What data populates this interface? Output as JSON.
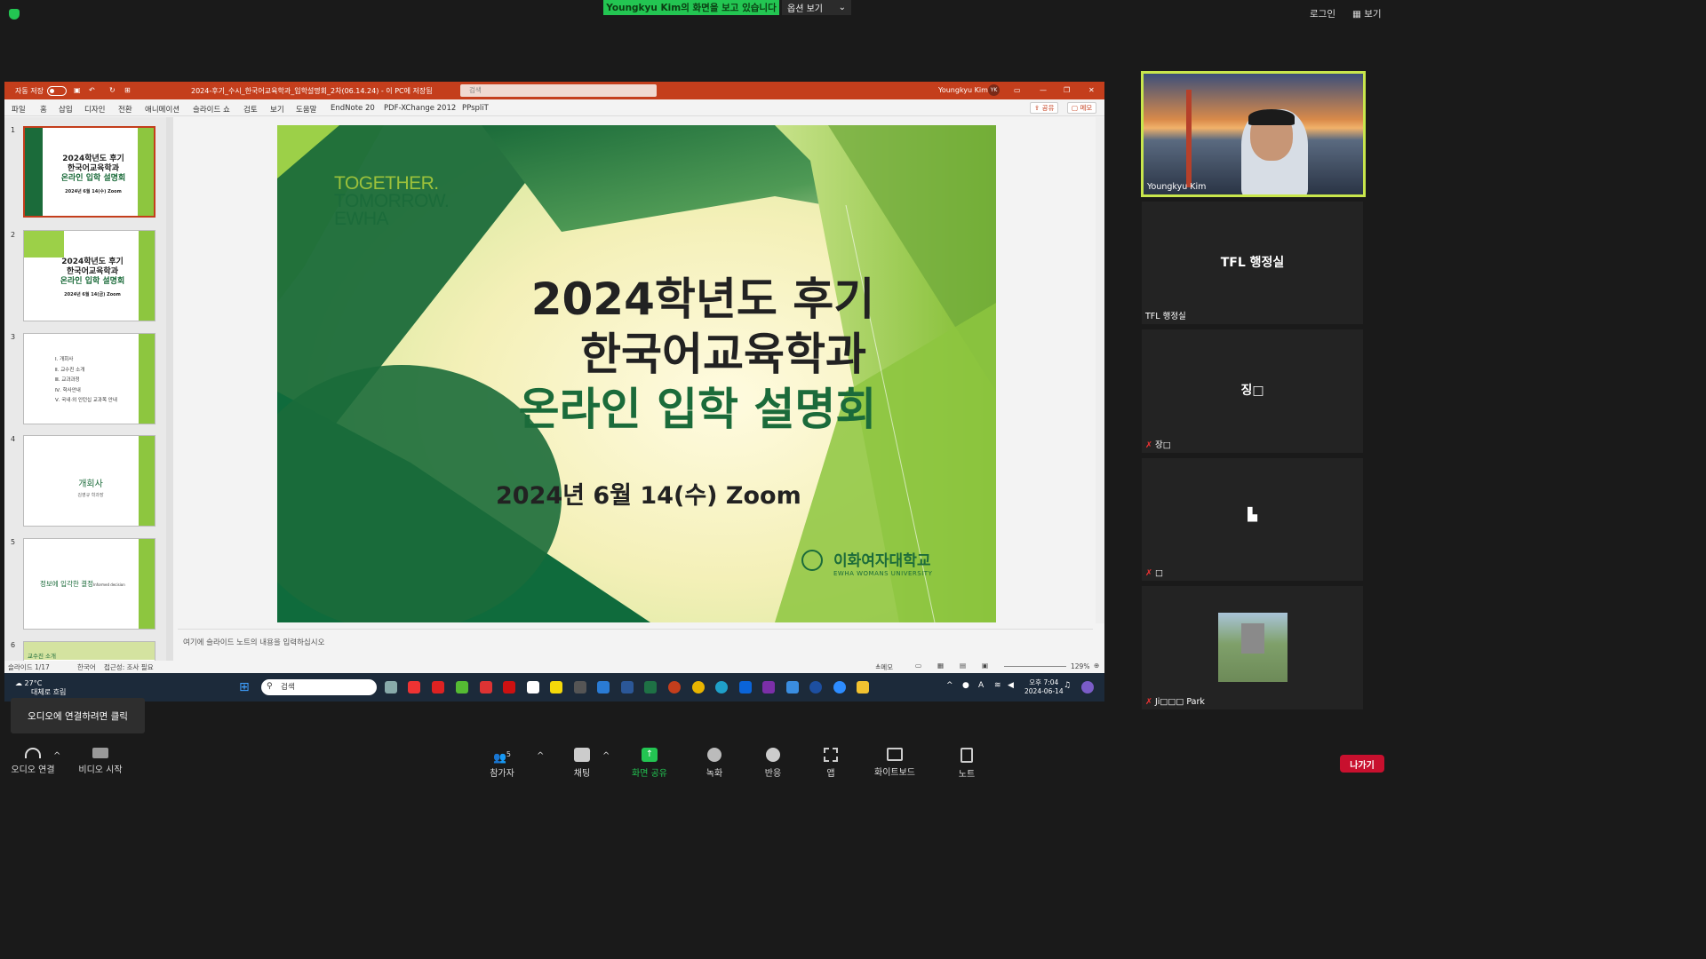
{
  "zoom": {
    "banner": "Youngkyu  Kim의 화면을 보고 있습니다",
    "view_options": "옵션 보기",
    "login": "로그인",
    "view": "보기",
    "audio_tooltip": "오디오에 연결하려면 클릭",
    "participants_count": "5",
    "controls": {
      "audio": "오디오 연결",
      "video": "비디오 시작",
      "participants": "참가자",
      "chat": "채팅",
      "share": "화면 공유",
      "record": "녹화",
      "reactions": "반응",
      "apps": "앱",
      "whiteboard": "화이트보드",
      "notes": "노트",
      "leave": "나가기"
    },
    "tiles": [
      {
        "name": "Youngkyu Kim"
      },
      {
        "center": "TFL 행정실",
        "name": "TFL 행정실"
      },
      {
        "center": "징□",
        "name": "장□"
      },
      {
        "center": "▙",
        "name": "□"
      },
      {
        "name": "Ji□□□ Park"
      }
    ]
  },
  "ppt": {
    "autosave": "자동 저장",
    "file_title": "2024-후기_수시_한국어교육학과_입학설명회_2차(06.14.24) - 이 PC에 저장됨",
    "search_placeholder": "검색",
    "user": "Youngkyu Kim",
    "user_initials": "YK",
    "tabs": [
      "파일",
      "홈",
      "삽입",
      "디자인",
      "전환",
      "애니메이션",
      "슬라이드 쇼",
      "검토",
      "보기",
      "도움말",
      "EndNote 20",
      "PDF-XChange 2012",
      "PPspliT"
    ],
    "share_label": "공유",
    "comment_label": "메모",
    "notes_placeholder": "여기에 슬라이드 노트의 내용을 입력하십시오",
    "status_slide": "슬라이드 1/17",
    "status_lang": "한국어",
    "status_access": "접근성: 조사 필요",
    "status_notes": "메모",
    "zoom_level": "129%",
    "thumbnails": [
      {
        "num": "1",
        "l1": "2024학년도 후기",
        "l2": "한국어교육학과",
        "l3": "온라인 입학 설명회",
        "l4": "2024년 6월 14(수) Zoom"
      },
      {
        "num": "2",
        "l1": "2024학년도 후기",
        "l2": "한국어교육학과",
        "l3": "온라인 입학 설명회",
        "l4": "2024년 6월 14(금) Zoom"
      },
      {
        "num": "3",
        "items": [
          "Ⅰ. 개회사",
          "Ⅱ. 교수진 소개",
          "Ⅲ. 교과과정",
          "Ⅳ. 학사안내",
          "Ⅴ. 국내·외 인턴십 교과목 안내"
        ]
      },
      {
        "num": "4",
        "l1": "개회사",
        "l2": "김영규 학과장"
      },
      {
        "num": "5",
        "l1": "정보에 입각한 결정",
        "l2": "Informed decision"
      },
      {
        "num": "6",
        "l1": "교수진 소개"
      }
    ],
    "slide": {
      "logo_l1": "TOGETHER.",
      "logo_l2": "TOMORROW.",
      "logo_l3": "EWHA",
      "title1": "2024학년도 후기",
      "title2": "한국어교육학과",
      "title3": "온라인 입학 설명회",
      "date": "2024년 6월 14(수) Zoom",
      "univ_kr": "이화여자대학교",
      "univ_en": "EWHA WOMANS UNIVERSITY"
    }
  },
  "taskbar": {
    "weather_temp": "27°C",
    "weather_desc": "대체로 흐림",
    "search": "검색",
    "time": "오후 7:04",
    "date": "2024-06-14"
  },
  "colors": {
    "ppt_red": "#c43e1c",
    "ewha_green": "#1b6b3a",
    "zoom_green": "#23c552",
    "leave_red": "#c8102e"
  }
}
